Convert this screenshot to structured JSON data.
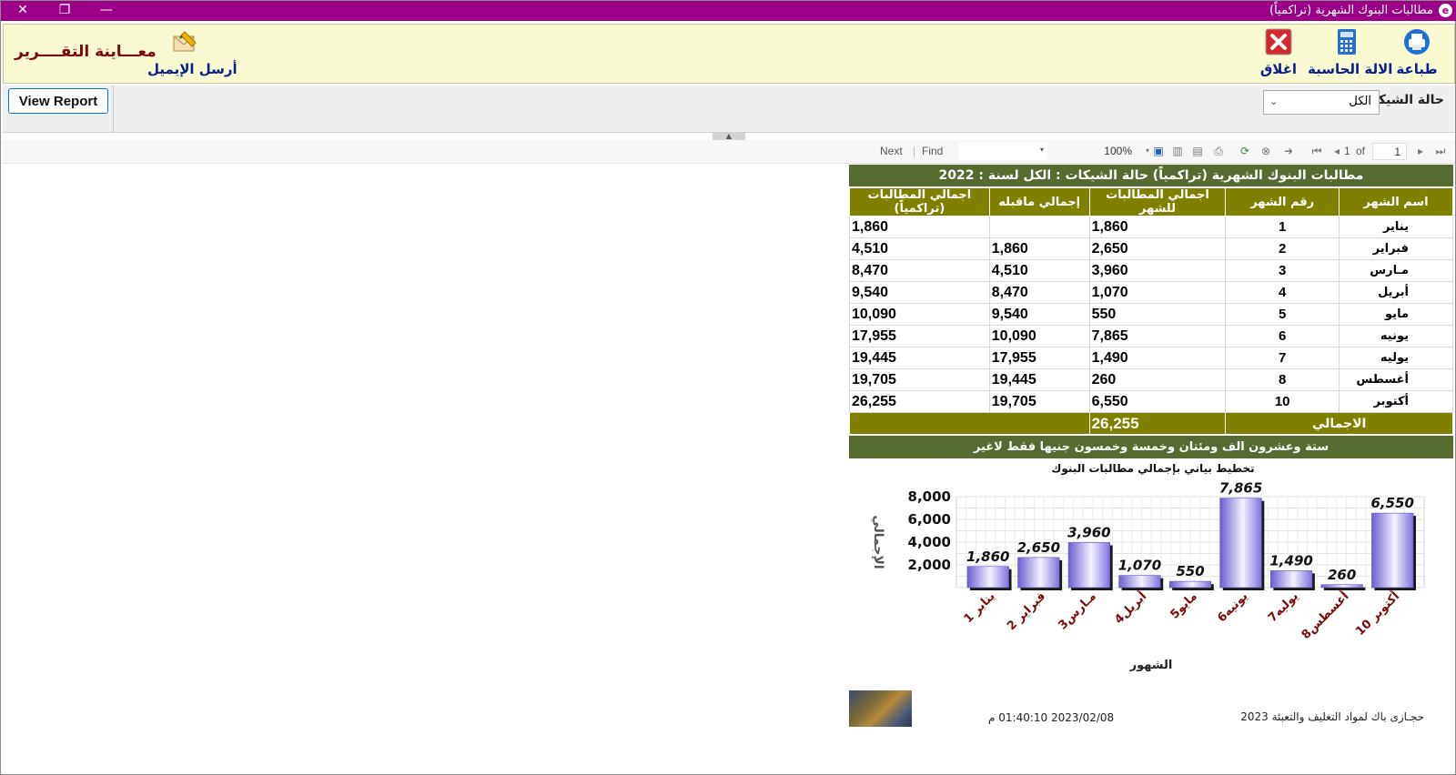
{
  "window": {
    "title": "مطالبات البنوك الشهرية (تراكمياً)"
  },
  "toolbar": {
    "print_label": "طباعة",
    "calculator_label": "الالة الحاسبة",
    "close_label": "اغلاق",
    "email_label": "أرسل الإيميل",
    "preview_title": "معـــاينة التقــــرير"
  },
  "params": {
    "check_status_label": "حالة الشيكات",
    "check_status_value": "الكل",
    "view_report_label": "View Report"
  },
  "report_toolbar": {
    "page_current": "1",
    "page_of": "of",
    "page_total": "1",
    "zoom": "100%",
    "find_label": "Find",
    "next_label": "Next"
  },
  "report": {
    "title": "مطالبات البنوك الشهرية (تراكمياً) حالة الشيكات : الكل  لسنة : 2022",
    "columns": [
      "اسم الشهر",
      "رقم الشهر",
      "اجمالي المطالبات للشهر",
      "إجمالي ماقبله",
      "اجمالي المطالبات (تراكمياً)"
    ],
    "rows": [
      {
        "month": "يناير",
        "num": "1",
        "amount": "1,860",
        "before": "",
        "cumulative": "1,860"
      },
      {
        "month": "فبراير",
        "num": "2",
        "amount": "2,650",
        "before": "1,860",
        "cumulative": "4,510"
      },
      {
        "month": "مـارس",
        "num": "3",
        "amount": "3,960",
        "before": "4,510",
        "cumulative": "8,470"
      },
      {
        "month": "أبريل",
        "num": "4",
        "amount": "1,070",
        "before": "8,470",
        "cumulative": "9,540"
      },
      {
        "month": "مايو",
        "num": "5",
        "amount": "550",
        "before": "9,540",
        "cumulative": "10,090"
      },
      {
        "month": "يونيه",
        "num": "6",
        "amount": "7,865",
        "before": "10,090",
        "cumulative": "17,955"
      },
      {
        "month": "يوليه",
        "num": "7",
        "amount": "1,490",
        "before": "17,955",
        "cumulative": "19,445"
      },
      {
        "month": "أغسطس",
        "num": "8",
        "amount": "260",
        "before": "19,445",
        "cumulative": "19,705"
      },
      {
        "month": "أكتوبر",
        "num": "10",
        "amount": "6,550",
        "before": "19,705",
        "cumulative": "26,255"
      }
    ],
    "total_label": "الاجمالي",
    "total_value": "26,255",
    "total_words": "ستة وعشرون الف ومئتان وخمسة وخمسون جنيها فقط لاغير"
  },
  "chart_data": {
    "type": "bar",
    "title": "تخطيط بياني بإجمالي مطالبات البنوك",
    "xlabel": "الشهور",
    "ylabel": "الإجمالي",
    "categories": [
      "يناير 1",
      "فبراير 2",
      "مـارس3",
      "أبريل4",
      "مايو5",
      "يونيه6",
      "يوليه7",
      "أغسطس8",
      "أكتوبر 10"
    ],
    "values": [
      1860,
      2650,
      3960,
      1070,
      550,
      7865,
      1490,
      260,
      6550
    ],
    "data_labels": [
      "1,860",
      "2,650",
      "3,960",
      "1,070",
      "550",
      "7,865",
      "1,490",
      "260",
      "6,550"
    ],
    "yticks": [
      "2,000",
      "4,000",
      "6,000",
      "8,000"
    ],
    "ylim": [
      0,
      8000
    ],
    "grid": true,
    "bar_color": "#8f87e0"
  },
  "footer": {
    "company": "حجـازى باك لمواد التغليف والتعبئة 2023",
    "datetime": "2023/02/08 01:40:10 م"
  }
}
